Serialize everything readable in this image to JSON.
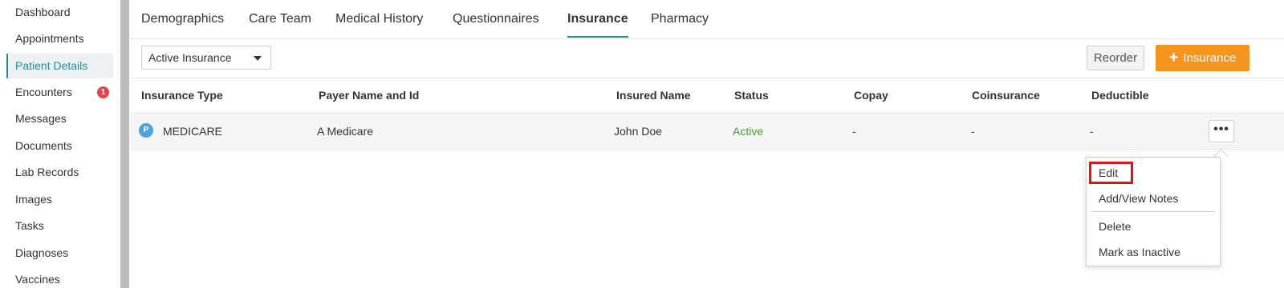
{
  "sidebar": {
    "items": [
      {
        "label": "Dashboard"
      },
      {
        "label": "Appointments"
      },
      {
        "label": "Patient Details",
        "active": true
      },
      {
        "label": "Encounters",
        "badge": "1"
      },
      {
        "label": "Messages"
      },
      {
        "label": "Documents"
      },
      {
        "label": "Lab Records"
      },
      {
        "label": "Images"
      },
      {
        "label": "Tasks"
      },
      {
        "label": "Diagnoses"
      },
      {
        "label": "Vaccines"
      }
    ]
  },
  "tabs": [
    {
      "label": "Demographics"
    },
    {
      "label": "Care Team"
    },
    {
      "label": "Medical History"
    },
    {
      "label": "Questionnaires"
    },
    {
      "label": "Insurance",
      "active": true
    },
    {
      "label": "Pharmacy"
    }
  ],
  "toolbar": {
    "filter_value": "Active Insurance",
    "reorder_label": "Reorder",
    "add_label": "Insurance",
    "add_icon": "+"
  },
  "table": {
    "headers": [
      "Insurance Type",
      "Payer Name and Id",
      "Insured Name",
      "Status",
      "Copay",
      "Coinsurance",
      "Deductible"
    ],
    "rows": [
      {
        "type_badge": "P",
        "type": "MEDICARE",
        "payer": "A Medicare",
        "insured": "John Doe",
        "status": "Active",
        "copay": "-",
        "coinsurance": "-",
        "deductible": "-",
        "actions_icon": "•••"
      }
    ]
  },
  "menu": {
    "items": [
      {
        "label": "Edit"
      },
      {
        "label": "Add/View Notes"
      },
      {
        "label": "Delete"
      },
      {
        "label": "Mark as Inactive"
      }
    ]
  },
  "colors": {
    "accent": "#2a8a92",
    "add_button": "#f7941d",
    "status_active": "#4a9a3a",
    "badge": "#e8424b",
    "highlight": "#ee1111"
  }
}
